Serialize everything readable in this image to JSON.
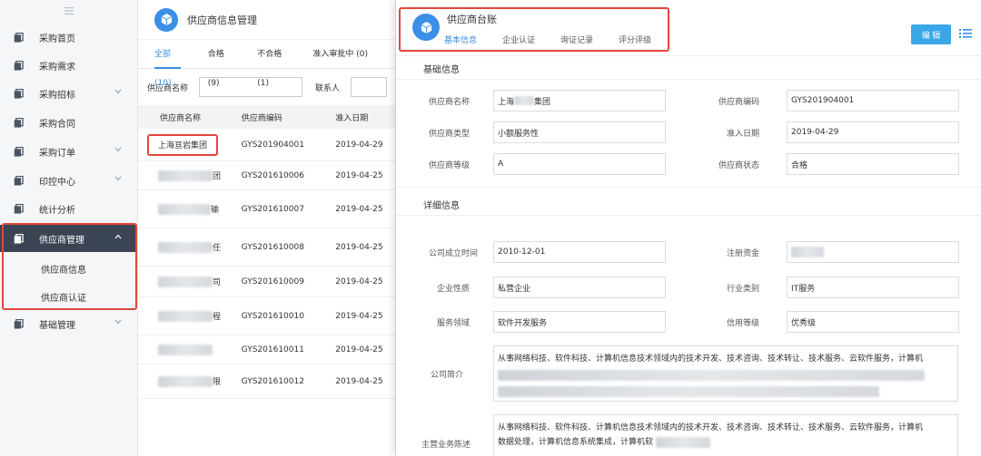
{
  "sidebar": {
    "items": [
      {
        "label": "采购首页",
        "icon": "document-icon",
        "chevron": false
      },
      {
        "label": "采购需求",
        "icon": "document-icon",
        "chevron": false
      },
      {
        "label": "采购招标",
        "icon": "document-icon",
        "chevron": true
      },
      {
        "label": "采购合同",
        "icon": "document-icon",
        "chevron": false
      },
      {
        "label": "采购订单",
        "icon": "document-icon",
        "chevron": true
      },
      {
        "label": "印控中心",
        "icon": "document-icon",
        "chevron": true
      },
      {
        "label": "统计分析",
        "icon": "document-icon",
        "chevron": false
      },
      {
        "label": "供应商管理",
        "icon": "document-icon",
        "chevron": true,
        "active": true
      },
      {
        "label": "基础管理",
        "icon": "document-icon",
        "chevron": true
      }
    ],
    "subitems": [
      "供应商信息",
      "供应商认证"
    ]
  },
  "list": {
    "title": "供应商信息管理",
    "tabs": [
      "全部 (10)",
      "合格 (9)",
      "不合格 (1)",
      "准入审批中 (0)"
    ],
    "filter": {
      "name_label": "供应商名称",
      "contact_label": "联系人"
    },
    "columns": [
      "供应商名称",
      "供应商编码",
      "准入日期"
    ],
    "rows": [
      {
        "name": "上海亘岩集团",
        "code": "GYS201904001",
        "date": "2019-04-29"
      },
      {
        "name": "团",
        "code": "GYS201610006",
        "date": "2019-04-25"
      },
      {
        "name": "输",
        "code": "GYS201610007",
        "date": "2019-04-25"
      },
      {
        "name": "任",
        "code": "GYS201610008",
        "date": "2019-04-25"
      },
      {
        "name": "司",
        "code": "GYS201610009",
        "date": "2019-04-25"
      },
      {
        "name": "程",
        "code": "GYS201610010",
        "date": "2019-04-25"
      },
      {
        "name": "",
        "code": "GYS201610011",
        "date": "2019-04-25"
      },
      {
        "name": "限",
        "code": "GYS201610012",
        "date": "2019-04-25"
      }
    ]
  },
  "detail": {
    "title": "供应商台账",
    "tabs": [
      "基本信息",
      "企业认证",
      "询证记录",
      "评分评级"
    ],
    "edit_label": "编 辑",
    "basic_title": "基础信息",
    "detail_title": "详细信息",
    "basic": {
      "name_label": "供应商名称",
      "name_prefix": "上海",
      "name_suffix": "集团",
      "code_label": "供应商编码",
      "code": "GYS201904001",
      "type_label": "供应商类型",
      "type": "小额服务性",
      "date_label": "准入日期",
      "date": "2019-04-29",
      "grade_label": "供应商等级",
      "grade": "A",
      "status_label": "供应商状态",
      "status": "合格"
    },
    "detail": {
      "founded_label": "公司成立时间",
      "founded": "2010-12-01",
      "capital_label": "注册资金",
      "nature_label": "企业性质",
      "nature": "私营企业",
      "industry_label": "行业类别",
      "industry": "IT服务",
      "field_label": "服务领域",
      "field": "软件开发服务",
      "credit_label": "信用等级",
      "credit": "优秀级",
      "intro_label": "公司简介",
      "intro": "从事网络科技、软件科技、计算机信息技术领域内的技术开发、技术咨询、技术转让、技术服务、云软件服务，计算机",
      "business_label": "主营业务陈述",
      "business_line1": "从事网络科技、软件科技、计算机信息技术领域内的技术开发、技术咨询、技术转让、技术服务、云软件服务，计算机",
      "business_line2": "数据处理，计算机信息系统集成，计算机软"
    }
  },
  "colors": {
    "accent": "#3a8ee6",
    "highlight": "#e2463a",
    "sidebar_active": "#3b4453",
    "edit_button": "#3aa7e6"
  }
}
